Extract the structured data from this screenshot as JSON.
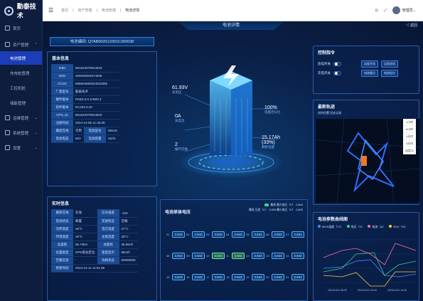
{
  "app": {
    "logo": "勤泰技术"
  },
  "sidebar": {
    "items": [
      {
        "label": "首页",
        "icon": "home-icon"
      },
      {
        "label": "资产管理",
        "icon": "asset-icon",
        "expanded": true
      },
      {
        "label": "电池管理",
        "sub": true,
        "active": true
      },
      {
        "label": "充电桩管理",
        "sub": true
      },
      {
        "label": "工控机柜",
        "sub": true
      },
      {
        "label": "储能管理",
        "sub": true
      },
      {
        "label": "运维管理",
        "icon": "ops-icon"
      },
      {
        "label": "系统管理",
        "icon": "system-icon"
      },
      {
        "label": "设置",
        "icon": "settings-icon"
      }
    ]
  },
  "header": {
    "breadcrumbs": [
      "首页",
      "资产管理",
      "电池管理",
      "电池详情"
    ],
    "user": "管理员"
  },
  "page": {
    "title": "电池详情",
    "back": "返回",
    "sn": "电池编码: QTAB002012001C300038"
  },
  "basic": {
    "title": "基本信息",
    "rows": [
      [
        "IMEI",
        "861542070644942"
      ],
      [
        "IMSI",
        "460046923074936"
      ],
      [
        "ICCID",
        "898604692024022855"
      ],
      [
        "厂家型号",
        "勤泰技术"
      ],
      [
        "硬件版本",
        "PKB3.0.0.1HW0.3"
      ],
      [
        "软件版本",
        "EC203.0.20"
      ],
      [
        "GPS_ID",
        "861542070644942"
      ],
      [
        "注册时间",
        "2024-12-05 11:48:25"
      ]
    ],
    "pairs": [
      [
        "最后在线",
        "可用",
        "电池型号",
        "8604S"
      ],
      [
        "电池电压",
        "60V",
        "电池容量",
        "45Ah"
      ]
    ]
  },
  "battery": {
    "voltage": "61.93V",
    "voltage_label": "总电压",
    "current": "0A",
    "current_label": "总电流",
    "cycles": "2",
    "cycles_label": "循环次数",
    "soc": "100%",
    "soc_label": "电量百分比",
    "remain": "15.17Ah (33%)",
    "remain_label": "剩余电量"
  },
  "control": {
    "title": "控制指令",
    "rows": [
      {
        "label": "放电开关",
        "buttons": [
          "远程开机",
          "远程关机"
        ]
      },
      {
        "label": "充电开关",
        "buttons": [
          "电池复位",
          "电池定位"
        ]
      }
    ]
  },
  "track": {
    "title": "最新轨迹",
    "subtitle": "实时位置  历史记录",
    "zoom": [
      "1小时",
      "6小时",
      "1天内",
      "3天内",
      "自定义"
    ]
  },
  "realtime": {
    "title": "实时信息",
    "rows": [
      [
        "最新在线",
        "在线",
        "信号强度",
        "-103"
      ],
      [
        "电池状态",
        "静置",
        "充放状态",
        "空载"
      ],
      [
        "功率温度",
        "28°C",
        "电芯温度",
        "27°C"
      ],
      [
        "环境温度",
        "29°C",
        "主板温度",
        "28°C"
      ],
      [
        "总里程",
        "85.74km",
        "总能耗",
        "36.69Ah"
      ],
      [
        "位置类型",
        "GPS基站定位",
        "速度显示",
        "5km/h"
      ],
      [
        "告警信息",
        "-",
        "功耗状态",
        "00000000"
      ],
      [
        "更新时间",
        "2024-12-11 11:51:06"
      ]
    ]
  },
  "cells": {
    "title": "电池单体电压",
    "legend_max": "最高",
    "legend_min": "最低",
    "max_label": "最大电压（V）: 3.844",
    "diff_label": "压差（V）: 0.000",
    "min_label": "最小电压（V）: 3.843",
    "values": [
      "3.843",
      "3.843",
      "3.843",
      "3.843",
      "3.843",
      "3.843",
      "3.843",
      "3.843",
      "3.843",
      "3.843",
      "3.843",
      "3.843",
      "3.843",
      "3.843",
      "3.843",
      "3.843",
      "3.843",
      "3.843",
      "3.843",
      "3.843",
      "3.843"
    ],
    "greens": [
      9,
      10
    ]
  },
  "params": {
    "title": "电池参数曲线图",
    "legend": [
      {
        "name": "MOS温度（°C）",
        "color": "#4a8cff"
      },
      {
        "name": "电压（V）",
        "color": "#3fd18b"
      },
      {
        "name": "电流（A）",
        "color": "#ff6ea8"
      },
      {
        "name": "SOC（%）",
        "color": "#ffc94a"
      }
    ],
    "xlabels": [
      "2024/12/11 08:00",
      "2024/12/11 09:00",
      "2024/12/11 10:00"
    ]
  }
}
